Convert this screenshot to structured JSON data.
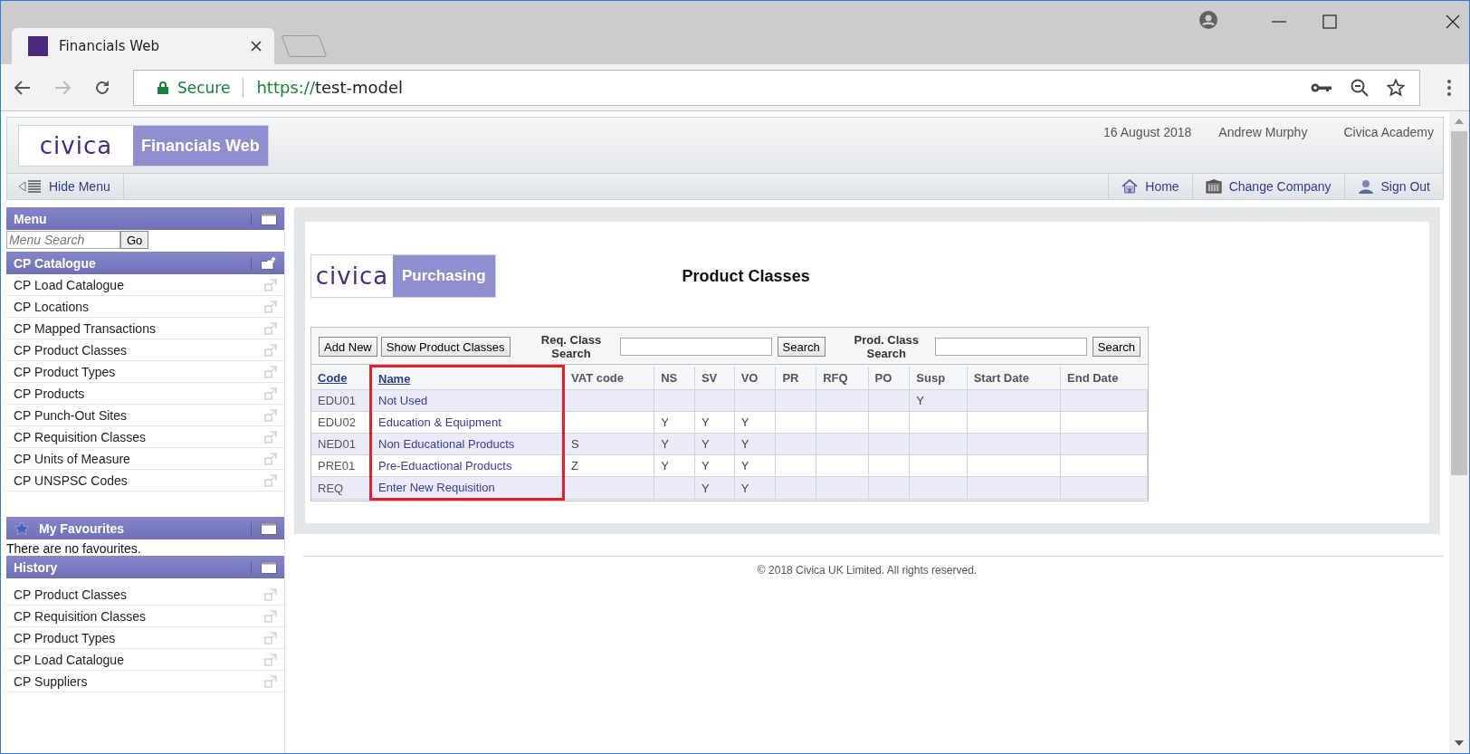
{
  "browser": {
    "tab_title": "Financials Web",
    "secure_label": "Secure",
    "url_scheme": "https://",
    "url_host": "test-model"
  },
  "header": {
    "logo": "civica",
    "product": "Financials Web",
    "date": "16 August 2018",
    "user": "Andrew Murphy",
    "company": "Civica Academy",
    "hide_menu": "Hide Menu",
    "nav": [
      {
        "kind": "home",
        "label": "Home"
      },
      {
        "kind": "company",
        "label": "Change Company"
      },
      {
        "kind": "signout",
        "label": "Sign Out"
      }
    ]
  },
  "sidebar": {
    "menu_title": "Menu",
    "search_placeholder": "Menu Search",
    "go": "Go",
    "catalogue_title": "CP Catalogue",
    "catalogue_items": [
      "CP Load Catalogue",
      "CP Locations",
      "CP Mapped Transactions",
      "CP Product Classes",
      "CP Product Types",
      "CP Products",
      "CP Punch-Out Sites",
      "CP Requisition Classes",
      "CP Units of Measure",
      "CP UNSPSC Codes"
    ],
    "favourites_title": "My Favourites",
    "favourites_empty": "There are no favourites.",
    "history_title": "History",
    "history_items": [
      "CP Product Classes",
      "CP Requisition Classes",
      "CP Product Types",
      "CP Load Catalogue",
      "CP Suppliers"
    ]
  },
  "content": {
    "logo": "civica",
    "product": "Purchasing",
    "title": "Product Classes",
    "buttons": [
      "Add New",
      "Show Product Classes"
    ],
    "searches": [
      {
        "label": "Req. Class Search",
        "button": "Search"
      },
      {
        "label": "Prod. Class Search",
        "button": "Search"
      }
    ],
    "table": {
      "columns": [
        {
          "label": "Code",
          "link": true,
          "highlighted": false
        },
        {
          "label": "Name",
          "link": true,
          "highlighted": true
        },
        {
          "label": "VAT code",
          "link": false,
          "highlighted": false
        },
        {
          "label": "NS",
          "link": false,
          "highlighted": false
        },
        {
          "label": "SV",
          "link": false,
          "highlighted": false
        },
        {
          "label": "VO",
          "link": false,
          "highlighted": false
        },
        {
          "label": "PR",
          "link": false,
          "highlighted": false
        },
        {
          "label": "RFQ",
          "link": false,
          "highlighted": false
        },
        {
          "label": "PO",
          "link": false,
          "highlighted": false
        },
        {
          "label": "Susp",
          "link": false,
          "highlighted": false
        },
        {
          "label": "Start Date",
          "link": false,
          "highlighted": false
        },
        {
          "label": "End Date",
          "link": false,
          "highlighted": false
        }
      ],
      "rows": [
        [
          "EDU01",
          "Not Used",
          "",
          "",
          "",
          "",
          "",
          "",
          "",
          "Y",
          "",
          ""
        ],
        [
          "EDU02",
          "Education & Equipment",
          "",
          "Y",
          "Y",
          "Y",
          "",
          "",
          "",
          "",
          "",
          ""
        ],
        [
          "NED01",
          "Non Educational Products",
          "S",
          "Y",
          "Y",
          "Y",
          "",
          "",
          "",
          "",
          "",
          ""
        ],
        [
          "PRE01",
          "Pre-Eduactional Products",
          "Z",
          "Y",
          "Y",
          "Y",
          "",
          "",
          "",
          "",
          "",
          ""
        ],
        [
          "REQ",
          "Enter New Requisition",
          "",
          "",
          "Y",
          "Y",
          "",
          "",
          "",
          "",
          "",
          ""
        ]
      ]
    }
  },
  "footer": "© 2018 Civica UK Limited. All rights reserved."
}
